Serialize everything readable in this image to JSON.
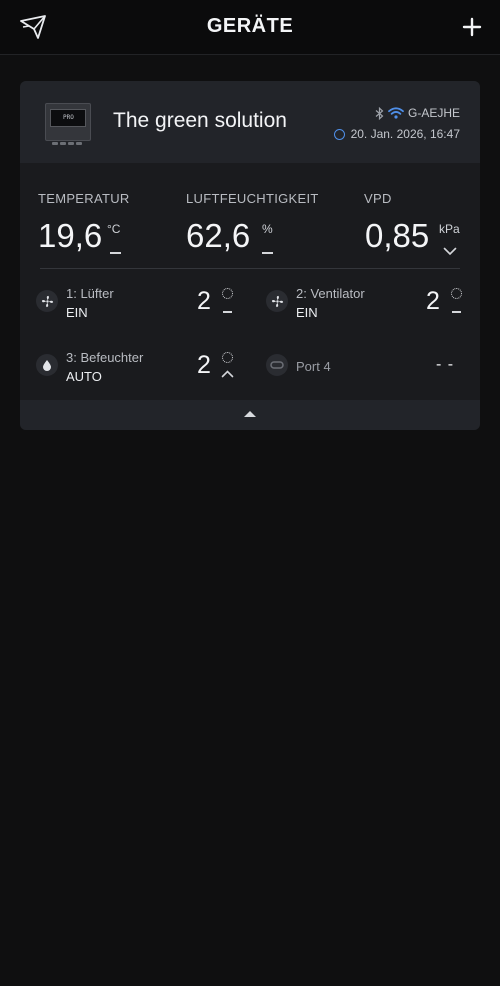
{
  "header": {
    "title": "GERÄTE",
    "logo_icon": "paper-plane-icon",
    "add_icon": "plus-icon"
  },
  "device": {
    "name": "The green solution",
    "model_badge": "PRO",
    "device_id": "G-AEJHE",
    "timestamp": "20. Jan. 2026, 16:47",
    "connection_icons": [
      "bluetooth-icon",
      "wifi-icon"
    ],
    "accent_color": "#4f8fe8"
  },
  "metrics": {
    "temperature": {
      "label": "TEMPERATUR",
      "value": "19,6",
      "unit": "°C"
    },
    "humidity": {
      "label": "LUFTFEUCHTIGKEIT",
      "value": "62,6",
      "unit": "%"
    },
    "vpd": {
      "label": "VPD",
      "value": "0,85",
      "unit": "kPa"
    }
  },
  "ports": [
    {
      "name": "1: Lüfter",
      "mode": "EIN",
      "level": "2",
      "icon": "fan-icon"
    },
    {
      "name": "2: Ventilator",
      "mode": "EIN",
      "level": "2",
      "icon": "fan-icon"
    },
    {
      "name": "3: Befeuchter",
      "mode": "AUTO",
      "level": "2",
      "icon": "water-drop-icon"
    },
    {
      "name": "Port 4",
      "mode": "",
      "level": "- -",
      "icon": "plug-icon"
    }
  ]
}
